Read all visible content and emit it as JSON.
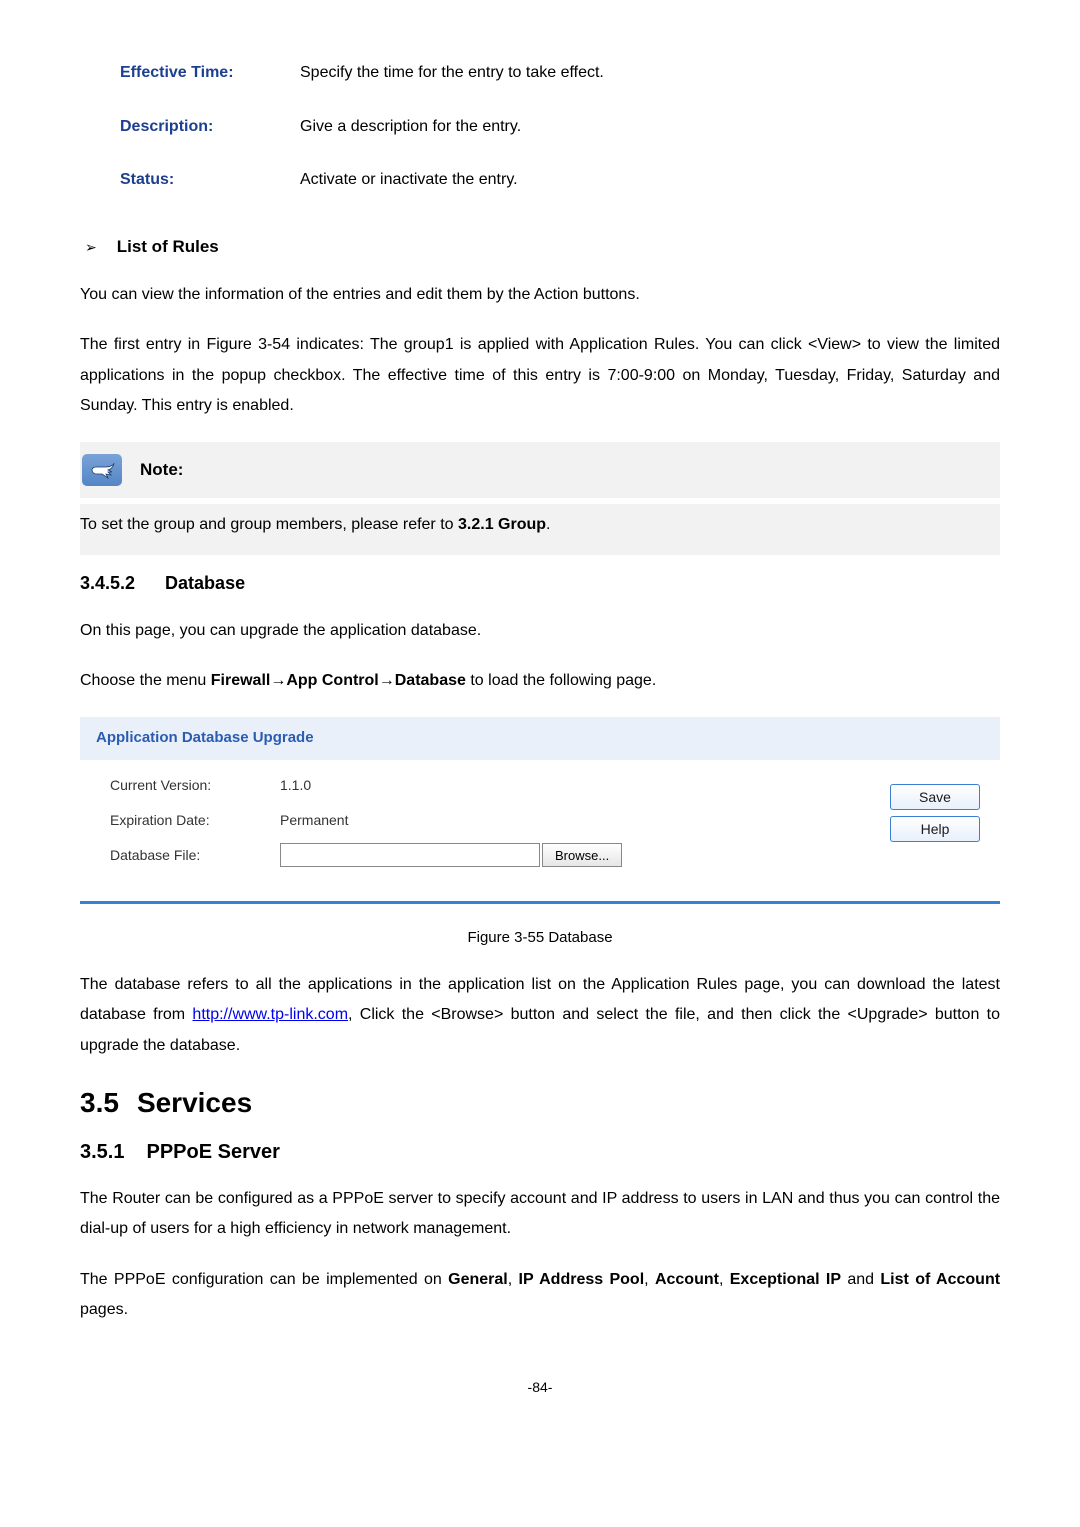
{
  "definitions": [
    {
      "label": "Effective Time:",
      "value": "Specify the time for the entry to take effect."
    },
    {
      "label": "Description:",
      "value": "Give a description for the entry."
    },
    {
      "label": "Status:",
      "value": "Activate or inactivate the entry."
    }
  ],
  "list_of_rules": {
    "heading": "List of Rules",
    "intro": "You can view the information of the entries and edit them by the Action buttons.",
    "body": "The first entry in Figure 3-54 indicates: The group1 is applied with Application Rules. You can click <View> to view the limited applications in the popup checkbox. The effective time of this entry is 7:00-9:00 on Monday, Tuesday, Friday, Saturday and Sunday. This entry is enabled."
  },
  "note": {
    "label": "Note:",
    "body_prefix": "To set the group and group members, please refer to ",
    "body_bold": "3.2.1 Group",
    "body_suffix": "."
  },
  "database": {
    "num": "3.4.5.2",
    "title": "Database",
    "intro": "On this page, you can upgrade the application database.",
    "menu_prefix": "Choose the menu ",
    "menu_bold": "Firewall→App Control→Database",
    "menu_suffix": " to load the following page.",
    "panel_title": "Application Database Upgrade",
    "rows": {
      "current_version_label": "Current Version:",
      "current_version_value": "1.1.0",
      "expiration_label": "Expiration Date:",
      "expiration_value": "Permanent",
      "file_label": "Database File:"
    },
    "browse_btn": "Browse...",
    "save_btn": "Save",
    "help_btn": "Help",
    "figure_caption": "Figure 3-55 Database",
    "desc_prefix": "The database refers to all the applications in the application list on the Application Rules page, you can download the latest database from ",
    "desc_link": "http://www.tp-link.com",
    "desc_suffix": ", Click the <Browse> button and select the file, and then click the <Upgrade> button to upgrade the database."
  },
  "services": {
    "num": "3.5",
    "title": "Services"
  },
  "pppoe": {
    "num": "3.5.1",
    "title": "PPPoE Server",
    "p1": "The Router can be configured as a PPPoE server to specify account and IP address to users in LAN and thus you can control the dial-up of users for a high efficiency in network management.",
    "p2_prefix": "The PPPoE configuration can be implemented on ",
    "p2_b1": "General",
    "p2_s1": ", ",
    "p2_b2": "IP Address Pool",
    "p2_s2": ", ",
    "p2_b3": "Account",
    "p2_s3": ", ",
    "p2_b4": "Exceptional IP",
    "p2_s4": " and ",
    "p2_b5": "List of Account",
    "p2_s5": " pages."
  },
  "page_number": "-84-"
}
